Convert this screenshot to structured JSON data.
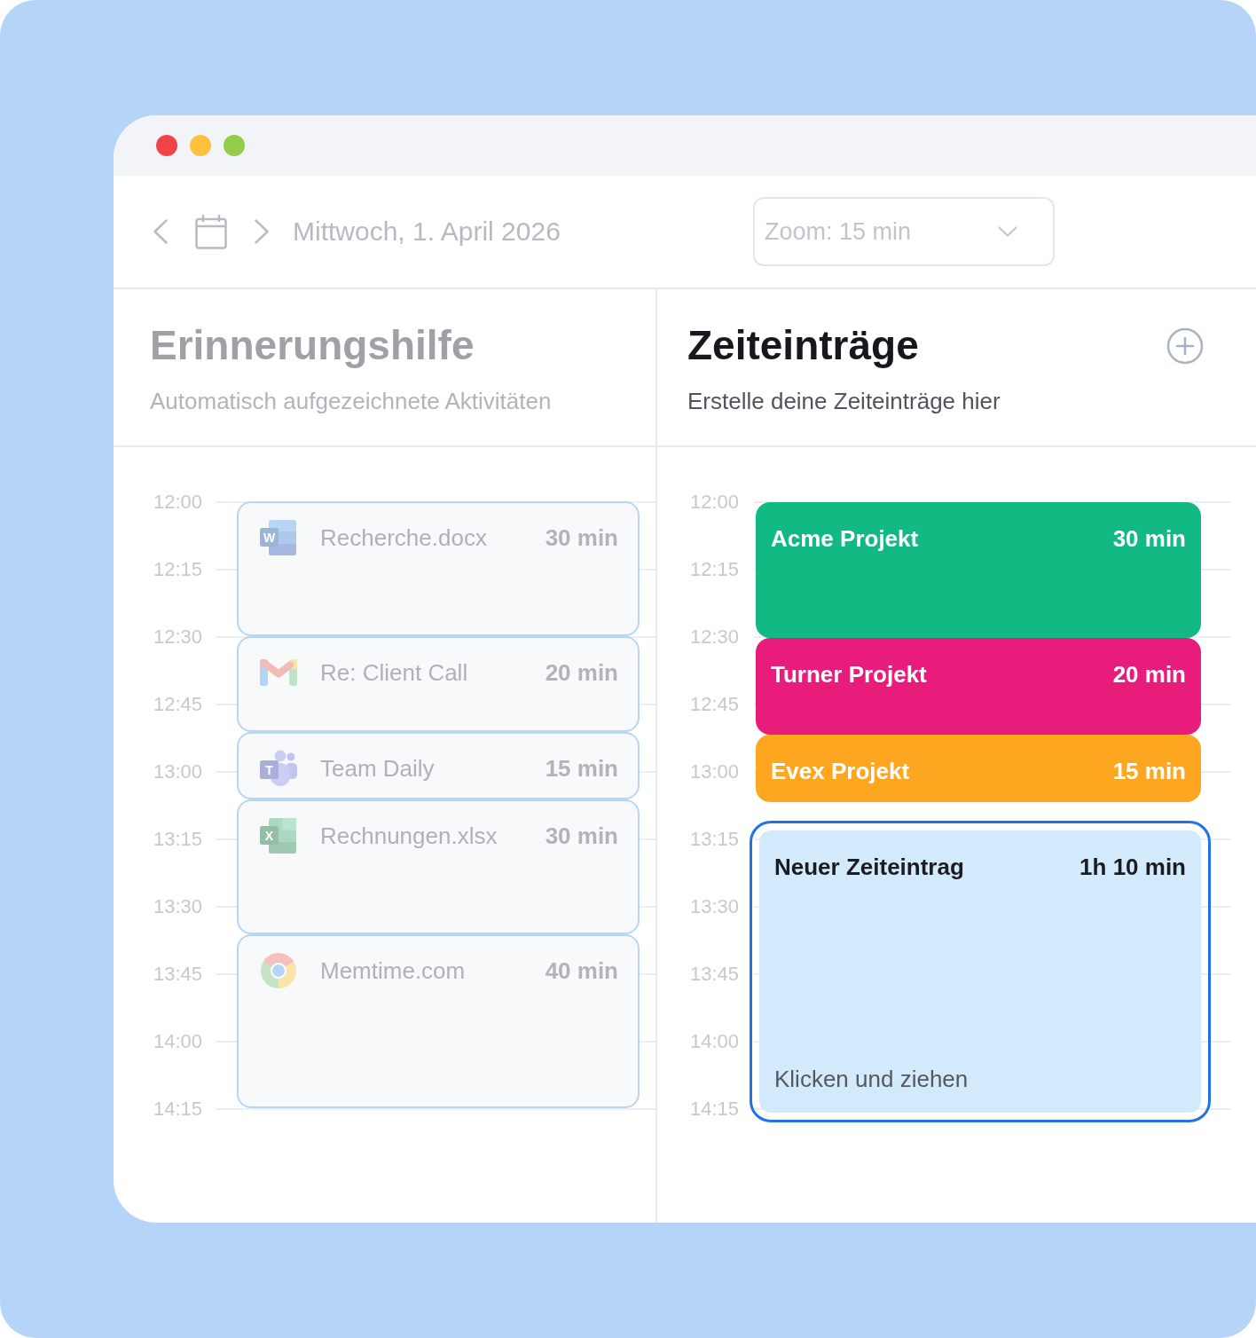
{
  "window_controls": [
    {
      "color": "#ef4349"
    },
    {
      "color": "#fec13e"
    },
    {
      "color": "#93cd4a"
    }
  ],
  "toolbar": {
    "date": "Mittwoch, 1. April 2026",
    "zoom_select": {
      "value": "Zoom: 15 min"
    }
  },
  "reminder_panel": {
    "title": "Erinnerungshilfe",
    "subtitle": "Automatisch aufgezeichnete Aktivitäten",
    "time_labels": [
      "12:00",
      "12:15",
      "12:30",
      "12:45",
      "13:00",
      "13:15",
      "13:30",
      "13:45",
      "14:00",
      "14:15"
    ],
    "activities": [
      {
        "kind": "document",
        "badge": "W",
        "title": "Recherche.docx",
        "duration": "30 min"
      },
      {
        "kind": "mail",
        "title": "Re: Client Call",
        "duration": "20 min"
      },
      {
        "kind": "meeting",
        "badge": "T",
        "title": "Team Daily",
        "duration": "15 min"
      },
      {
        "kind": "spreadsheet",
        "badge": "X",
        "title": "Rechnungen.xlsx",
        "duration": "30 min"
      },
      {
        "kind": "browser",
        "title": "Memtime.com",
        "duration": "40 min"
      }
    ]
  },
  "entries_panel": {
    "title": "Zeiteinträge",
    "subtitle": "Erstelle deine Zeiteinträge hier",
    "time_labels": [
      "12:00",
      "12:15",
      "12:30",
      "12:45",
      "13:00",
      "13:15",
      "13:30",
      "13:45",
      "14:00",
      "14:15"
    ],
    "entries": [
      {
        "kind": "project",
        "title": "Acme Projekt",
        "duration": "30 min",
        "color": "#13b982",
        "selected": false
      },
      {
        "kind": "project",
        "title": "Turner Projekt",
        "duration": "20 min",
        "color": "#e81c7a",
        "selected": false
      },
      {
        "kind": "project",
        "title": "Evex Projekt",
        "duration": "15 min",
        "color": "#fea620",
        "selected": false
      },
      {
        "kind": "draft",
        "title": "Neuer Zeiteintrag",
        "duration": "1h 10 min",
        "hint": "Klicken und ziehen",
        "color": "#d3eafd",
        "selected": true
      }
    ]
  }
}
